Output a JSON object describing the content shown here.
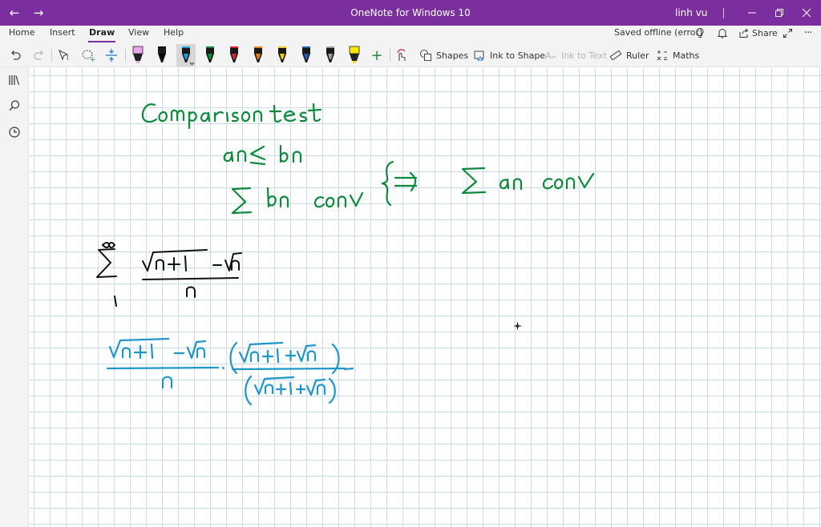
{
  "window": {
    "title": "OneNote for Windows 10",
    "user": "linh vu"
  },
  "ribbon": {
    "tabs": [
      {
        "label": "Home"
      },
      {
        "label": "Insert"
      },
      {
        "label": "Draw"
      },
      {
        "label": "View"
      },
      {
        "label": "Help"
      }
    ],
    "active_tab": "Draw",
    "status": "Saved offline (error)",
    "share_label": "Share"
  },
  "toolbar": {
    "shapes_label": "Shapes",
    "ink_to_shape_label": "Ink to Shape",
    "ink_to_text_label": "Ink to Text",
    "ruler_label": "Ruler",
    "maths_label": "Maths",
    "pens": [
      {
        "color": "#e6a8e8",
        "kind": "highlighter"
      },
      {
        "color": "#000000",
        "kind": "pen"
      },
      {
        "color": "#1e9fd6",
        "kind": "pen",
        "selected": true
      },
      {
        "color": "#0c8a3a",
        "kind": "pen"
      },
      {
        "color": "#d4242c",
        "kind": "pen"
      },
      {
        "color": "#f07d1a",
        "kind": "pen"
      },
      {
        "color": "#f5c518",
        "kind": "pen"
      },
      {
        "color": "#1a5fb4",
        "kind": "pen"
      },
      {
        "color": "#9a9a9a",
        "kind": "pen"
      },
      {
        "color": "#f7e600",
        "kind": "highlighter"
      }
    ]
  },
  "colors": {
    "accent": "#7b2f9e",
    "ink_green": "#0c8a3a",
    "ink_black": "#111111",
    "ink_blue": "#1e96c8"
  },
  "leftrail": {
    "icons": [
      "notebooks-icon",
      "search-icon",
      "recent-icon"
    ]
  }
}
